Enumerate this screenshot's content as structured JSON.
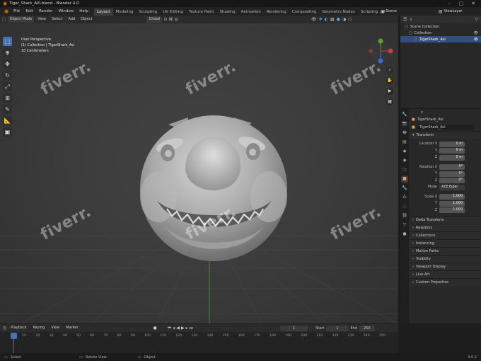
{
  "titlebar": {
    "title": "Tiger_Shark_AVI.blend - Blender 4.0"
  },
  "menu": [
    "File",
    "Edit",
    "Render",
    "Window",
    "Help"
  ],
  "workspaces": [
    {
      "label": "Layout",
      "active": true
    },
    {
      "label": "Modeling"
    },
    {
      "label": "Sculpting"
    },
    {
      "label": "UV Editing"
    },
    {
      "label": "Texture Paint"
    },
    {
      "label": "Shading"
    },
    {
      "label": "Animation"
    },
    {
      "label": "Rendering"
    },
    {
      "label": "Compositing"
    },
    {
      "label": "Geometry Nodes"
    },
    {
      "label": "Scripting"
    }
  ],
  "scene": {
    "scene_label": "Scene",
    "view_layer_label": "ViewLayer"
  },
  "header3d": {
    "mode": "Object Mode",
    "view": "View",
    "select": "Select",
    "add": "Add",
    "object": "Object",
    "orientation": "Global",
    "options": "Options"
  },
  "viewport": {
    "perspective": "User Perspective",
    "collection_path": "(1) Collection | TigerShark_Avi",
    "scale": "10 Centimeters"
  },
  "outliner": {
    "root": "Scene Collection",
    "collection": "Collection",
    "object": "TigerShark_Avi"
  },
  "properties": {
    "object_name": "TigerShark_Avi",
    "data_name": "TigerShark_Avi",
    "transform_label": "Transform",
    "location_label": "Location X",
    "rotation_label": "Rotation X",
    "scale_label": "Scale X",
    "axis": [
      "Y",
      "Z"
    ],
    "location": [
      "0 m",
      "0 m",
      "0 m"
    ],
    "rotation": [
      "0°",
      "0°",
      "0°"
    ],
    "mode_label": "Mode",
    "mode": "XYZ Euler",
    "scale": [
      "1.000",
      "1.000",
      "1.000"
    ],
    "panels": [
      "Delta Transform",
      "Relations",
      "Collections",
      "Instancing",
      "Motion Paths",
      "Visibility",
      "Viewport Display",
      "Line Art",
      "Custom Properties"
    ]
  },
  "timeline": {
    "playback": "Playback",
    "keying": "Keying",
    "view": "View",
    "marker": "Marker",
    "current_frame": "1",
    "start_label": "Start",
    "start": "1",
    "end_label": "End",
    "end": "250",
    "ticks": [
      "1",
      "10",
      "20",
      "30",
      "40",
      "50",
      "60",
      "70",
      "80",
      "90",
      "100",
      "110",
      "120",
      "130",
      "140",
      "150",
      "160",
      "170",
      "180",
      "190",
      "200",
      "210",
      "220",
      "230",
      "240",
      "250"
    ]
  },
  "status": {
    "select": "Select",
    "rotate": "Rotate View",
    "object": "Object",
    "version": "4.0.2"
  },
  "watermark": "fiverr."
}
